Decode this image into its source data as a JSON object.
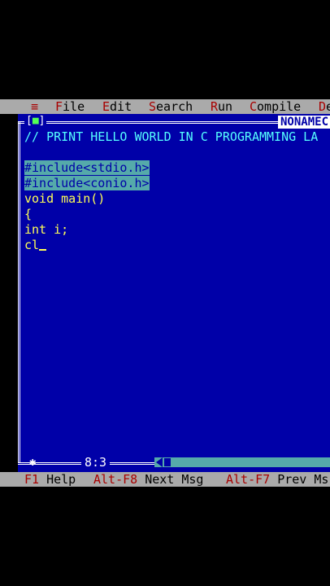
{
  "menu": {
    "system_icon": "≡",
    "items": [
      {
        "hot": "F",
        "rest": "ile"
      },
      {
        "hot": "E",
        "rest": "dit"
      },
      {
        "hot": "S",
        "rest": "earch"
      },
      {
        "hot": "R",
        "rest": "un"
      },
      {
        "hot": "C",
        "rest": "ompile"
      },
      {
        "hot": "D",
        "rest": "e"
      }
    ]
  },
  "window": {
    "close_box": "[",
    "close_mark": "■",
    "close_box_end": "]",
    "title": "NONAMEC"
  },
  "editor": {
    "lines": [
      {
        "text": "// PRINT HELLO WORLD IN C PROGRAMMING LA",
        "style": "comment"
      },
      {
        "text": "",
        "style": "normal"
      },
      {
        "text": "#include<stdio.h>",
        "style": "selected"
      },
      {
        "text": "#include<conio.h>",
        "style": "selected"
      },
      {
        "text": "void main()",
        "style": "normal"
      },
      {
        "text": "{",
        "style": "normal"
      },
      {
        "text": "int i;",
        "style": "normal"
      },
      {
        "text": "cl",
        "style": "normal"
      }
    ],
    "cursor_position": "8:3",
    "corner_glyph": "✱"
  },
  "statusbar": {
    "items": [
      {
        "key": "F1",
        "label": " Help"
      },
      {
        "key": "Alt-F8",
        "label": " Next Msg"
      },
      {
        "key": "Alt-F7",
        "label": " Prev Ms"
      }
    ]
  },
  "colors": {
    "background": "#0000a8",
    "menu_bg": "#aaaaaa",
    "hotkey": "#a80000",
    "code_text": "#ffff55",
    "selection_bg": "#55aaaa",
    "comment": "#55ffff"
  }
}
